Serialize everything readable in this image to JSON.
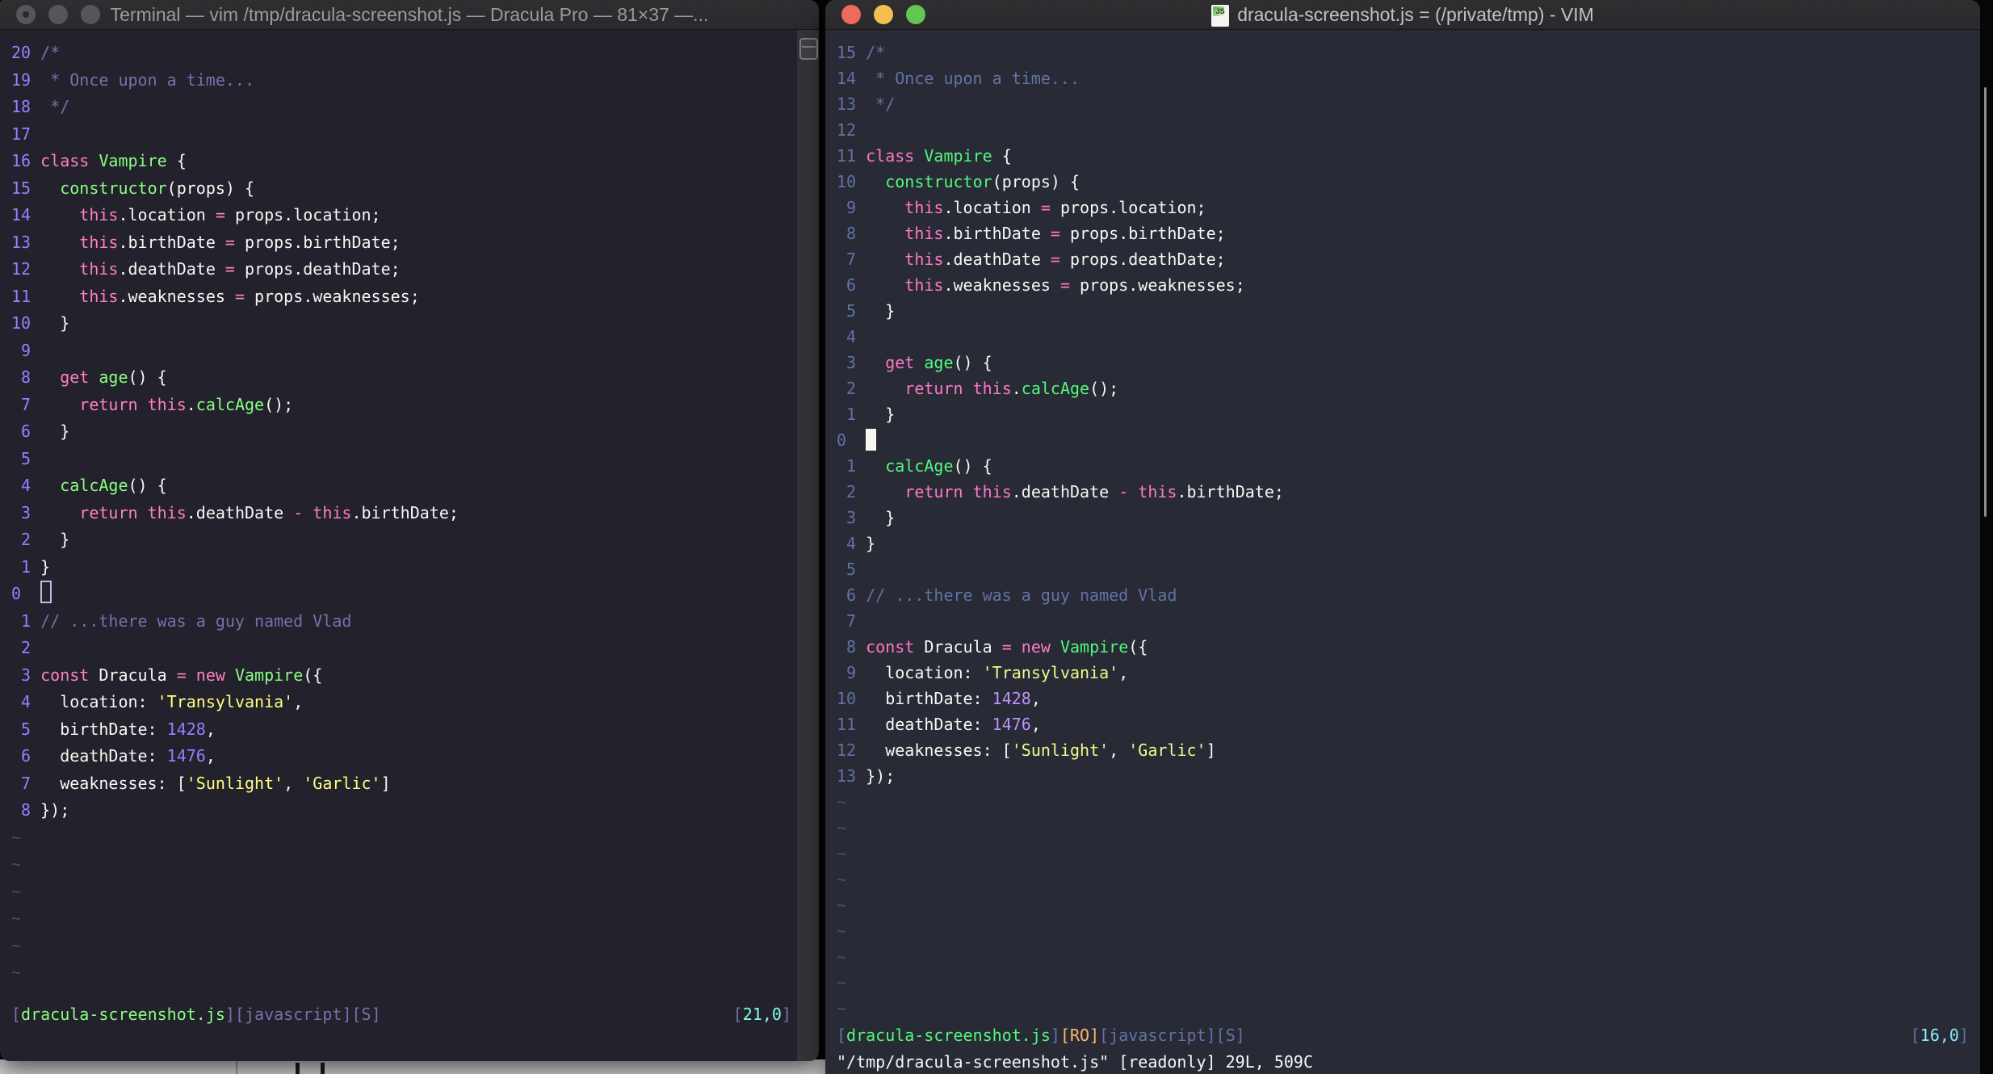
{
  "colors": {
    "left": {
      "bg": "#22212c",
      "fg": "#f8f8f2",
      "comment": "#7970a9",
      "pink": "#ff80bf",
      "green": "#8aff80",
      "purple": "#9580ff",
      "yellow": "#ffff80",
      "cyan": "#80ffea",
      "orange": "#ffca80",
      "line_num": "#9580ff",
      "tilde": "#4f4a6d",
      "cursor": "#c0bbe3"
    },
    "right": {
      "bg": "#282a36",
      "fg": "#f8f8f2",
      "comment": "#6272a4",
      "pink": "#ff79c6",
      "green": "#50fa7b",
      "purple": "#bd93f9",
      "yellow": "#f1fa8c",
      "cyan": "#8be9fd",
      "orange": "#ffb86c",
      "line_num": "#6272a4",
      "tilde": "#4a4f68",
      "cursor": "#f8f8f2"
    }
  },
  "code_lines": [
    [
      [
        "c",
        "/*"
      ]
    ],
    [
      [
        "c",
        " * Once upon a time..."
      ]
    ],
    [
      [
        "c",
        " */"
      ]
    ],
    [],
    [
      [
        "k",
        "class"
      ],
      [
        "d",
        " "
      ],
      [
        "g",
        "Vampire"
      ],
      [
        "d",
        " {"
      ]
    ],
    [
      [
        "d",
        "  "
      ],
      [
        "g",
        "constructor"
      ],
      [
        "d",
        "(props) {"
      ]
    ],
    [
      [
        "d",
        "    "
      ],
      [
        "k",
        "this"
      ],
      [
        "d",
        ".location "
      ],
      [
        "k",
        "="
      ],
      [
        "d",
        " props.location;"
      ]
    ],
    [
      [
        "d",
        "    "
      ],
      [
        "k",
        "this"
      ],
      [
        "d",
        ".birthDate "
      ],
      [
        "k",
        "="
      ],
      [
        "d",
        " props.birthDate;"
      ]
    ],
    [
      [
        "d",
        "    "
      ],
      [
        "k",
        "this"
      ],
      [
        "d",
        ".deathDate "
      ],
      [
        "k",
        "="
      ],
      [
        "d",
        " props.deathDate;"
      ]
    ],
    [
      [
        "d",
        "    "
      ],
      [
        "k",
        "this"
      ],
      [
        "d",
        ".weaknesses "
      ],
      [
        "k",
        "="
      ],
      [
        "d",
        " props.weaknesses;"
      ]
    ],
    [
      [
        "d",
        "  }"
      ]
    ],
    [],
    [
      [
        "d",
        "  "
      ],
      [
        "k",
        "get"
      ],
      [
        "d",
        " "
      ],
      [
        "g",
        "age"
      ],
      [
        "d",
        "() {"
      ]
    ],
    [
      [
        "d",
        "    "
      ],
      [
        "k",
        "return"
      ],
      [
        "d",
        " "
      ],
      [
        "k",
        "this"
      ],
      [
        "d",
        "."
      ],
      [
        "g",
        "calcAge"
      ],
      [
        "d",
        "();"
      ]
    ],
    [
      [
        "d",
        "  }"
      ]
    ],
    [],
    [
      [
        "d",
        "  "
      ],
      [
        "g",
        "calcAge"
      ],
      [
        "d",
        "() {"
      ]
    ],
    [
      [
        "d",
        "    "
      ],
      [
        "k",
        "return"
      ],
      [
        "d",
        " "
      ],
      [
        "k",
        "this"
      ],
      [
        "d",
        ".deathDate "
      ],
      [
        "k",
        "-"
      ],
      [
        "d",
        " "
      ],
      [
        "k",
        "this"
      ],
      [
        "d",
        ".birthDate;"
      ]
    ],
    [
      [
        "d",
        "  }"
      ]
    ],
    [
      [
        "d",
        "}"
      ]
    ],
    [],
    [
      [
        "c",
        "// ...there was a guy named Vlad"
      ]
    ],
    [],
    [
      [
        "k",
        "const"
      ],
      [
        "d",
        " Dracula "
      ],
      [
        "k",
        "="
      ],
      [
        "d",
        " "
      ],
      [
        "k",
        "new"
      ],
      [
        "d",
        " "
      ],
      [
        "g",
        "Vampire"
      ],
      [
        "d",
        "({"
      ]
    ],
    [
      [
        "d",
        "  location: "
      ],
      [
        "s",
        "'Transylvania'"
      ],
      [
        "d",
        ","
      ]
    ],
    [
      [
        "d",
        "  birthDate: "
      ],
      [
        "n",
        "1428"
      ],
      [
        "d",
        ","
      ]
    ],
    [
      [
        "d",
        "  deathDate: "
      ],
      [
        "n",
        "1476"
      ],
      [
        "d",
        ","
      ]
    ],
    [
      [
        "d",
        "  weaknesses: ["
      ],
      [
        "s",
        "'Sunlight'"
      ],
      [
        "d",
        ", "
      ],
      [
        "s",
        "'Garlic'"
      ],
      [
        "d",
        "]"
      ]
    ],
    [
      [
        "d",
        "});"
      ]
    ]
  ],
  "left_window": {
    "title": "Terminal — vim /tmp/dracula-screenshot.js — Dracula Pro — 81×37 —...",
    "cursor_line": 21,
    "cursor_type": "hollow",
    "tilde_count": 6,
    "statusline": [
      [
        "br",
        "["
      ],
      [
        "file",
        "dracula-screenshot.js"
      ],
      [
        "br",
        "]["
      ],
      [
        "flag",
        "javascript"
      ],
      [
        "br",
        "]["
      ],
      [
        "flag",
        "S"
      ],
      [
        "br",
        "]"
      ]
    ],
    "status_right": [
      [
        "br",
        "["
      ],
      [
        "pos",
        "21,0"
      ],
      [
        "br",
        "]"
      ]
    ],
    "command_line": ""
  },
  "right_window": {
    "title": "dracula-screenshot.js = (/private/tmp) - VIM",
    "cursor_line": 16,
    "cursor_type": "block",
    "tilde_count": 9,
    "statusline": [
      [
        "br",
        "["
      ],
      [
        "file",
        "dracula-screenshot.js"
      ],
      [
        "br",
        "]"
      ],
      [
        "ro",
        "[RO]"
      ],
      [
        "br",
        "["
      ],
      [
        "flag",
        "javascript"
      ],
      [
        "br",
        "]["
      ],
      [
        "flag",
        "S"
      ],
      [
        "br",
        "]"
      ]
    ],
    "status_right": [
      [
        "br",
        "["
      ],
      [
        "pos",
        "16,0"
      ],
      [
        "br",
        "]"
      ]
    ],
    "command_line": "\"/tmp/dracula-screenshot.js\" [readonly] 29L, 509C"
  }
}
